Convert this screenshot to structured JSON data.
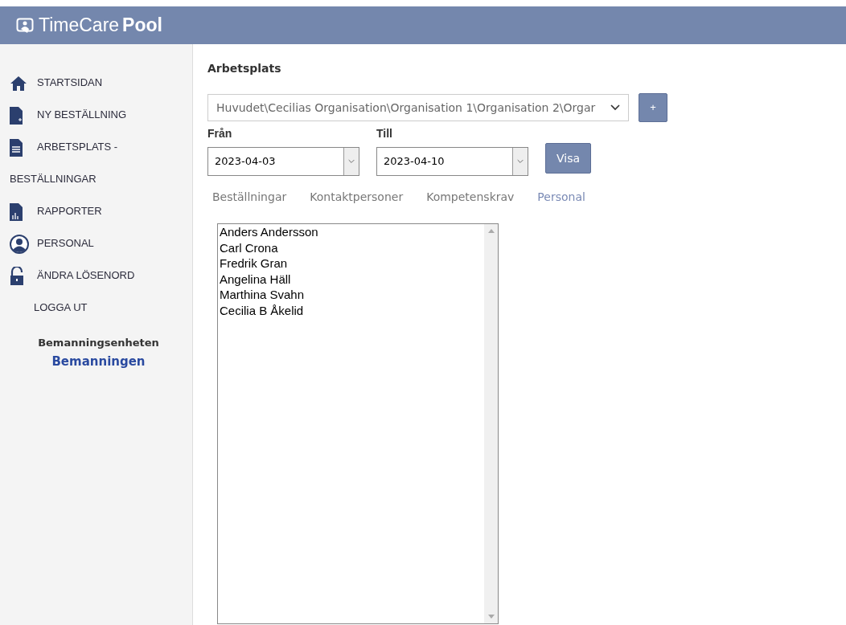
{
  "header": {
    "brand_light": "TimeCare",
    "brand_bold": "Pool"
  },
  "sidebar": {
    "items": [
      {
        "label": "STARTSIDAN"
      },
      {
        "label": "NY BESTÄLLNING"
      },
      {
        "label": "ARBETSPLATS - BESTÄLLNINGAR"
      },
      {
        "label": "RAPPORTER"
      },
      {
        "label": "PERSONAL"
      },
      {
        "label": "ÄNDRA LÖSENORD"
      },
      {
        "label": "LOGGA UT"
      }
    ],
    "unit_label": "Bemanningsenheten",
    "unit_name": "Bemanningen"
  },
  "workplace": {
    "label": "Arbetsplats",
    "value": "Huvudet\\Cecilias Organisation\\Organisation 1\\Organisation 2\\Orgar",
    "add_button": "+"
  },
  "from": {
    "label": "Från",
    "value": "2023-04-03"
  },
  "to": {
    "label": "Till",
    "value": "2023-04-10"
  },
  "show_button": "Visa",
  "tabs": [
    {
      "label": "Beställningar",
      "selected": false
    },
    {
      "label": "Kontaktpersoner",
      "selected": false
    },
    {
      "label": "Kompetenskrav",
      "selected": false
    },
    {
      "label": "Personal",
      "selected": true
    }
  ],
  "staff_list": [
    "Anders Andersson",
    "Carl Crona",
    "Fredrik Gran",
    "Angelina Häll",
    "Marthina Svahn",
    "Cecilia B Åkelid"
  ]
}
